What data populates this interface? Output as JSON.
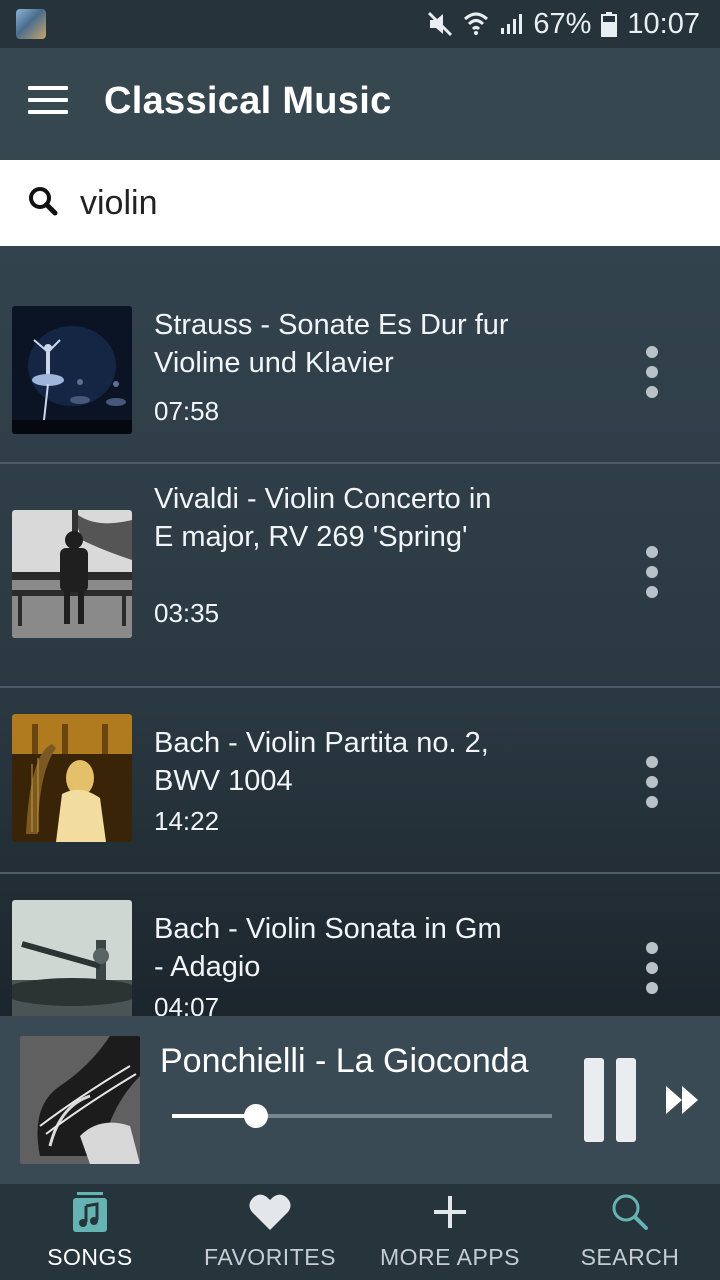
{
  "status_bar": {
    "battery": "67%",
    "time": "10:07",
    "icons": [
      "mute-icon",
      "wifi-icon",
      "signal-icon",
      "battery-icon"
    ]
  },
  "app_bar": {
    "title": "Classical Music",
    "menu_icon": "hamburger-menu-icon"
  },
  "search": {
    "value": "violin",
    "icon": "search-icon"
  },
  "songs": [
    {
      "title": "Strauss - Sonate Es Dur fur Violine und Klavier",
      "duration": "07:58"
    },
    {
      "title": "Vivaldi - Violin Concerto in E major, RV 269 'Spring'",
      "duration": "03:35"
    },
    {
      "title": "Bach - Violin Partita no. 2, BWV 1004",
      "duration": "14:22"
    },
    {
      "title": "Bach - Violin Sonata in Gm - Adagio",
      "duration": "04:07"
    }
  ],
  "player": {
    "title": "Ponchielli - La Gioconda",
    "progress": 0.22,
    "pause_icon": "pause-icon",
    "next_icon": "fast-forward-icon"
  },
  "bottom_nav": [
    {
      "label": "SONGS",
      "icon": "music-note-icon",
      "active": true
    },
    {
      "label": "FAVORITES",
      "icon": "heart-icon",
      "active": false
    },
    {
      "label": "MORE APPS",
      "icon": "plus-icon",
      "active": false
    },
    {
      "label": "SEARCH",
      "icon": "search-icon",
      "active": false
    }
  ],
  "colors": {
    "app_bar": "#37474f",
    "nav_active_icon": "#66b3b3",
    "nav_label": "#c5cdd2"
  }
}
